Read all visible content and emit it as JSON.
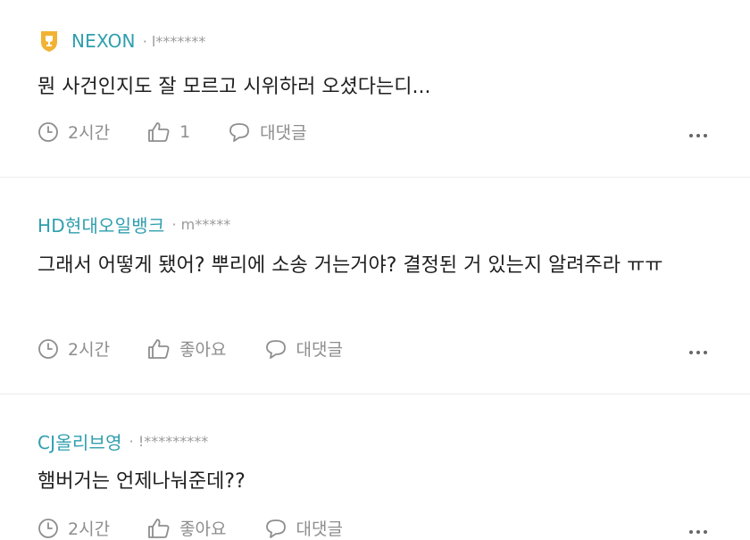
{
  "comments": [
    {
      "company": "NEXON",
      "author": "· l*******",
      "text": "뭔 사건인지도 잘 모르고 시위하러 오셨다는디...",
      "time": "2시간",
      "like": "1",
      "reply": "대댓글",
      "badge": "trophy-icon"
    },
    {
      "company": "HD현대오일뱅크",
      "author": "· m*****",
      "text": "그래서 어떻게 됐어? 뿌리에 소송 거는거야? 결정된 거 있는지 알려주라 ㅠㅠ",
      "time": "2시간",
      "like": "좋아요",
      "reply": "대댓글"
    },
    {
      "company": "CJ올리브영",
      "author": "· !*********",
      "text": "햄버거는 언제나눠준데??",
      "time": "2시간",
      "like": "좋아요",
      "reply": "대댓글"
    }
  ],
  "colors": {
    "company": "#2f9fae",
    "badge": "#f2b233",
    "muted": "#8e8e8e"
  }
}
